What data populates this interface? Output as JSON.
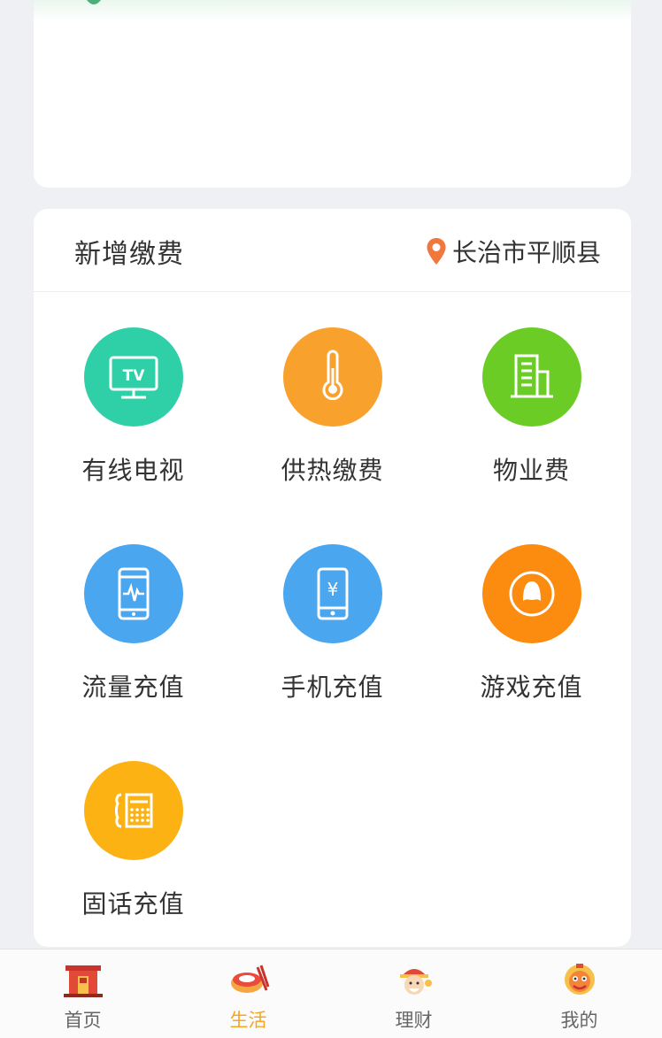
{
  "section": {
    "title": "新增缴费",
    "location": "长治市平顺县"
  },
  "services": [
    {
      "label": "有线电视",
      "icon": "tv-icon",
      "color": "#2fd0a8"
    },
    {
      "label": "供热缴费",
      "icon": "thermometer-icon",
      "color": "#f9a12d"
    },
    {
      "label": "物业费",
      "icon": "building-icon",
      "color": "#6ccc26"
    },
    {
      "label": "流量充值",
      "icon": "phone-data-icon",
      "color": "#4aa6ef"
    },
    {
      "label": "手机充值",
      "icon": "phone-yuan-icon",
      "color": "#4aa6ef"
    },
    {
      "label": "游戏充值",
      "icon": "game-qq-icon",
      "color": "#fb8c0f"
    },
    {
      "label": "固话充值",
      "icon": "landline-icon",
      "color": "#fbb212"
    }
  ],
  "tabs": [
    {
      "label": "首页",
      "icon": "home-gate-icon",
      "active": false
    },
    {
      "label": "生活",
      "icon": "life-bowl-icon",
      "active": true
    },
    {
      "label": "理财",
      "icon": "finance-fortune-icon",
      "active": false
    },
    {
      "label": "我的",
      "icon": "mine-lion-icon",
      "active": false
    }
  ],
  "colors": {
    "accent": "#f5a623",
    "location_pin": "#f0783c"
  }
}
